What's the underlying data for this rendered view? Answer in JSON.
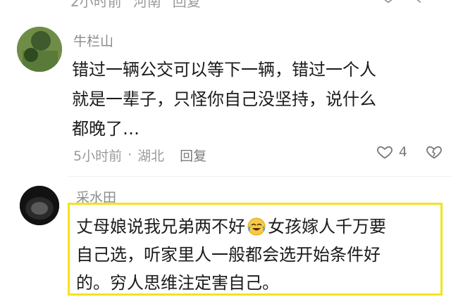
{
  "top_partial": {
    "time": "2小时前",
    "location": "河南",
    "reply": "回复"
  },
  "comments": [
    {
      "username": "牛栏山",
      "text_lines": [
        "错过一辆公交可以等下一辆，错过一个人",
        "就是一辈子，只怪你自己没坚持，说什么",
        "都晚了…"
      ],
      "time": "5小时前",
      "separator": "·",
      "location": "湖北",
      "reply": "回复",
      "like_count": "4",
      "icons": {
        "like": "heart-outline-icon",
        "dislike": "broken-heart-icon"
      }
    },
    {
      "username": "采水田",
      "text_line1_a": "丈母娘说我兄弟两不好",
      "emoji": "laughing-crying-emoji",
      "text_line1_b": "女孩嫁人千万要",
      "text_line2": "自己选，听家里人一般都会选开始条件好",
      "text_line3": "的。穷人思维注定害自己。",
      "highlight_color": "#f3e31c"
    }
  ]
}
